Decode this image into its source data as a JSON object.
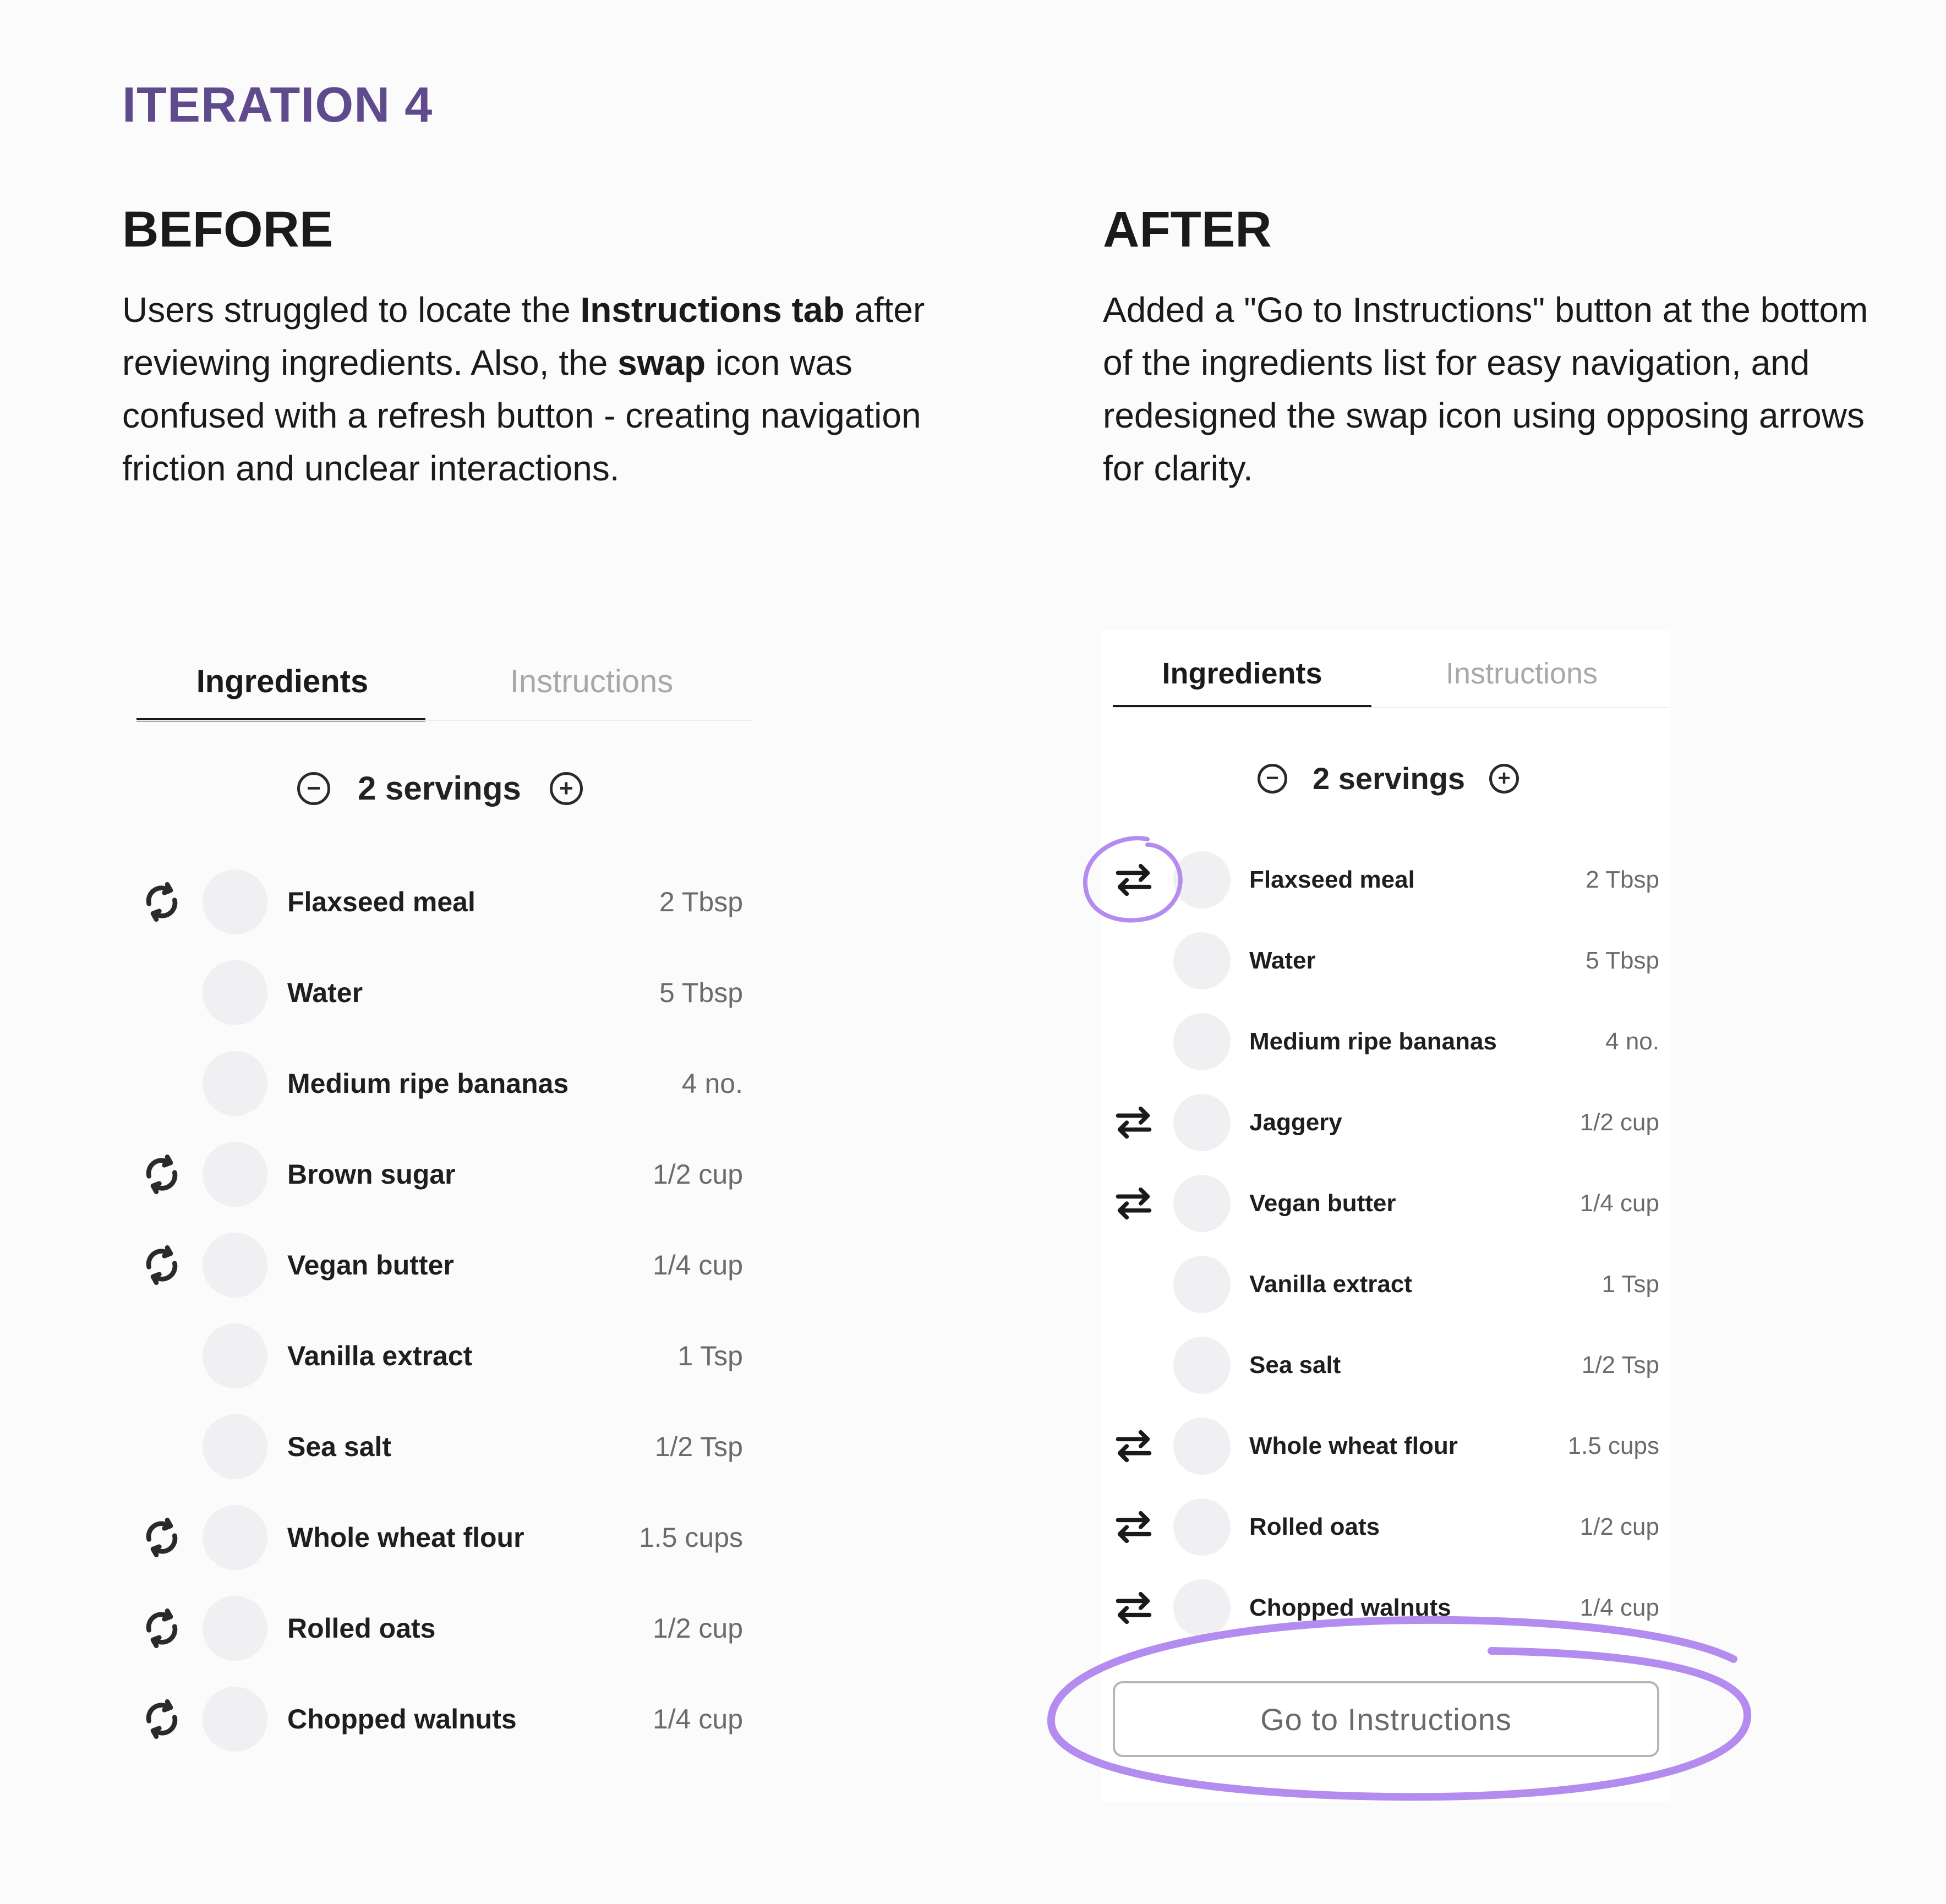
{
  "page": {
    "title": "ITERATION 4"
  },
  "before": {
    "heading": "BEFORE",
    "text": [
      "Users struggled to locate the ",
      "Instructions tab",
      " after reviewing ingredients. Also, the ",
      "swap",
      " icon was confused with a refresh button - creating navigation friction and unclear interactions."
    ],
    "tabs": {
      "active": "Ingredients",
      "inactive": "Instructions"
    },
    "servings": {
      "label": "2 servings",
      "minus": "−",
      "plus": "+"
    },
    "items": [
      {
        "name": "Flaxseed meal",
        "qty": "2 Tbsp",
        "swap": true
      },
      {
        "name": "Water",
        "qty": "5 Tbsp",
        "swap": false
      },
      {
        "name": "Medium ripe bananas",
        "qty": "4 no.",
        "swap": false
      },
      {
        "name": "Brown sugar",
        "qty": "1/2 cup",
        "swap": true
      },
      {
        "name": "Vegan butter",
        "qty": "1/4 cup",
        "swap": true
      },
      {
        "name": "Vanilla extract",
        "qty": "1 Tsp",
        "swap": false
      },
      {
        "name": "Sea salt",
        "qty": "1/2 Tsp",
        "swap": false
      },
      {
        "name": "Whole wheat flour",
        "qty": "1.5 cups",
        "swap": true
      },
      {
        "name": "Rolled oats",
        "qty": "1/2 cup",
        "swap": true
      },
      {
        "name": "Chopped walnuts",
        "qty": "1/4 cup",
        "swap": true
      }
    ],
    "swap_icon": "refresh-style-swap-icon"
  },
  "after": {
    "heading": "AFTER",
    "text": "Added a \"Go to Instructions\" button at the bottom of the ingredients list for easy navigation, and redesigned the swap icon using opposing arrows for clarity.",
    "tabs": {
      "active": "Ingredients",
      "inactive": "Instructions"
    },
    "servings": {
      "label": "2 servings",
      "minus": "−",
      "plus": "+"
    },
    "items": [
      {
        "name": "Flaxseed meal",
        "qty": "2 Tbsp",
        "swap": true
      },
      {
        "name": "Water",
        "qty": "5 Tbsp",
        "swap": false
      },
      {
        "name": "Medium ripe bananas",
        "qty": "4 no.",
        "swap": false
      },
      {
        "name": "Jaggery",
        "qty": "1/2 cup",
        "swap": true
      },
      {
        "name": "Vegan butter",
        "qty": "1/4 cup",
        "swap": true
      },
      {
        "name": "Vanilla extract",
        "qty": "1 Tsp",
        "swap": false
      },
      {
        "name": "Sea salt",
        "qty": "1/2 Tsp",
        "swap": false
      },
      {
        "name": "Whole wheat flour",
        "qty": "1.5 cups",
        "swap": true
      },
      {
        "name": "Rolled oats",
        "qty": "1/2 cup",
        "swap": true
      },
      {
        "name": "Chopped walnuts",
        "qty": "1/4 cup",
        "swap": true
      }
    ],
    "swap_icon": "opposing-arrows-swap-icon",
    "go_button": "Go to Instructions"
  },
  "colors": {
    "accent_title": "#5e4a8c",
    "highlight": "#b48cf0"
  }
}
